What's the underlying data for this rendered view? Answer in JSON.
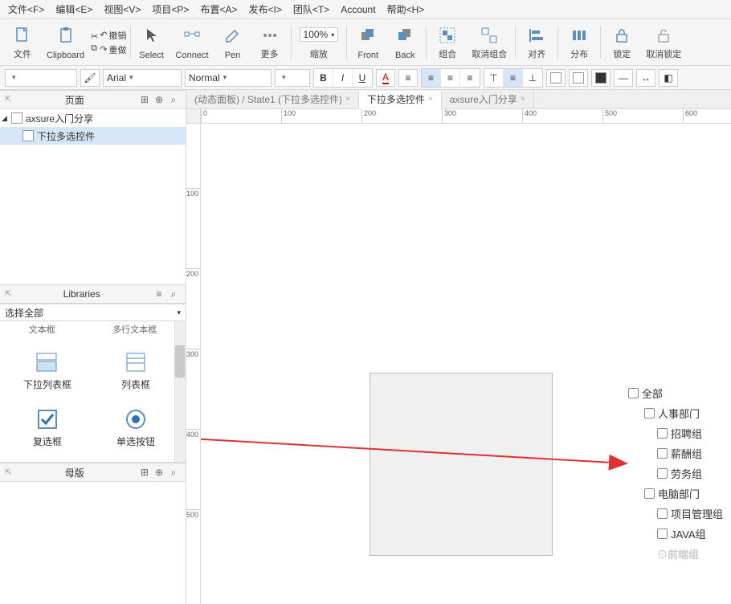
{
  "menu": [
    "文件<F>",
    "编辑<E>",
    "视图<V>",
    "项目<P>",
    "布置<A>",
    "发布<I>",
    "团队<T>",
    "Account",
    "帮助<H>"
  ],
  "toolbar": {
    "file_label": "文件",
    "clipboard_label": "Clipboard",
    "undo": "撤销",
    "redo": "重做",
    "select": "Select",
    "connect": "Connect",
    "pen": "Pen",
    "more": "更多",
    "zoom_value": "100%",
    "zoom_label": "缩放",
    "front": "Front",
    "back": "Back",
    "group": "组合",
    "ungroup": "取消组合",
    "align": "对齐",
    "distribute": "分布",
    "lock": "锁定",
    "unlock": "取消锁定"
  },
  "format": {
    "font": "Arial",
    "style": "Normal",
    "bold": "B",
    "italic": "I",
    "underline": "U",
    "textcolor": "A"
  },
  "panels": {
    "pages_title": "页面",
    "libraries_title": "Libraries",
    "lib_select": "选择全部",
    "masters_title": "母版"
  },
  "tree": {
    "root": "axsure入门分享",
    "child": "下拉多选控件"
  },
  "library": {
    "top_left": "文本框",
    "top_right": "多行文本框",
    "dropdown_list": "下拉列表框",
    "list_box": "列表框",
    "checkbox": "复选框",
    "radio": "单选按钮"
  },
  "tabs": {
    "tab1": "(动态面板) / State1 (下拉多选控件)",
    "tab2": "下拉多选控件",
    "tab3": "axsure入门分享"
  },
  "ruler": {
    "marks_h": [
      "0",
      "100",
      "200",
      "300",
      "400",
      "500",
      "600"
    ],
    "marks_v": [
      "100",
      "200",
      "300",
      "400",
      "500"
    ]
  },
  "checklist": {
    "all": "全部",
    "hr": "人事部门",
    "recruit": "招聘组",
    "salary": "薪酬组",
    "labor": "劳务组",
    "it": "电脑部门",
    "pm": "项目管理组",
    "java": "JAVA组",
    "watermark": "⊙前端组"
  }
}
